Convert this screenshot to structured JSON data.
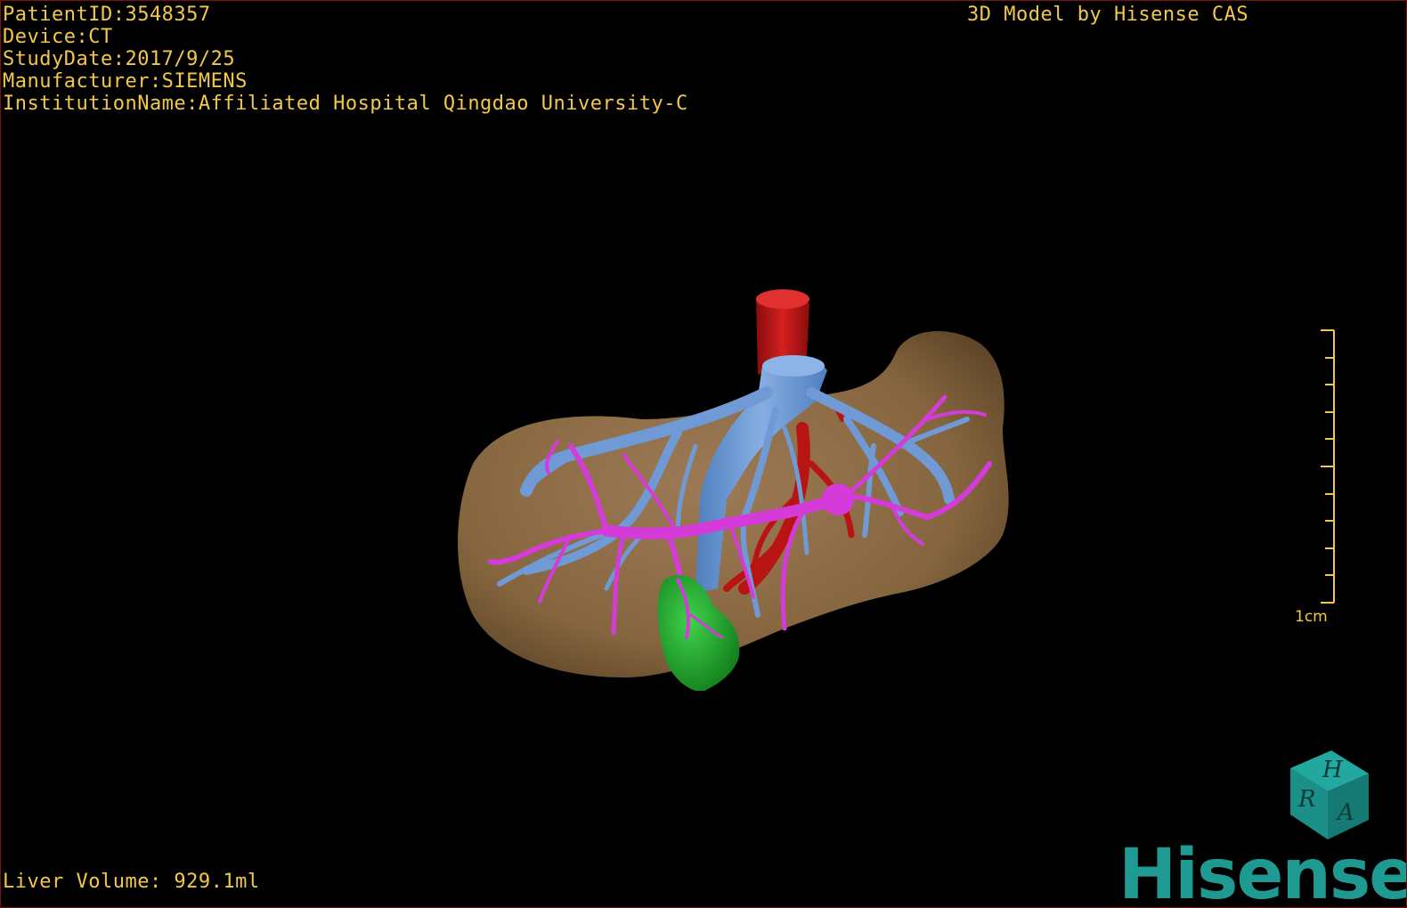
{
  "overlay": {
    "patient_id": "PatientID:3548357",
    "device": "Device:CT",
    "study_date": "StudyDate:2017/9/25",
    "manufacturer": "Manufacturer:SIEMENS",
    "institution": "InstitutionName:Affiliated Hospital Qingdao University-C",
    "model_credit": "3D Model by Hisense CAS",
    "liver_volume": "Liver Volume: 929.1ml"
  },
  "scale_bar": {
    "label": "1cm"
  },
  "orientation_cube": {
    "letters": [
      "H",
      "R",
      "A"
    ],
    "color": "#1e9a93"
  },
  "brand": {
    "name": "Hisense",
    "color": "#1e9a93"
  },
  "model_colors": {
    "liver": "#8b6a48",
    "hepatic_veins": "#6f9ad6",
    "portal_vein": "#d43bd9",
    "aorta_artery": "#b81414",
    "gallbladder": "#1fa32a"
  }
}
